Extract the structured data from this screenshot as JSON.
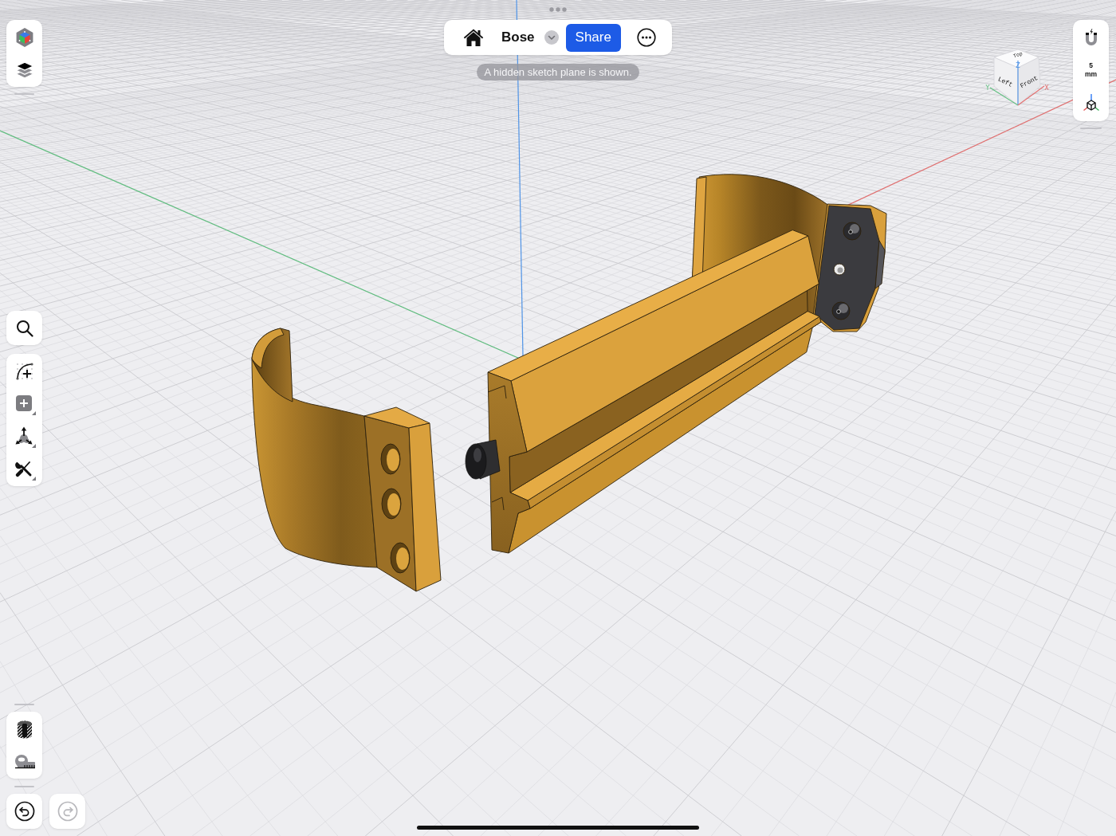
{
  "top_bar": {
    "document_name": "Bose",
    "share_label": "Share"
  },
  "notice": "A hidden sketch plane is shown.",
  "snap": {
    "value": "5",
    "unit": "mm"
  },
  "view_cube": {
    "faces": [
      {
        "kind": "top",
        "label": "Top"
      },
      {
        "kind": "left",
        "label": "Left"
      },
      {
        "kind": "front",
        "label": "Front"
      }
    ],
    "axes": [
      {
        "kind": "z",
        "label": "Z",
        "color": "#4f93e6"
      },
      {
        "kind": "y",
        "label": "Y",
        "color": "#5fbf7f"
      },
      {
        "kind": "x",
        "label": "X",
        "color": "#e46f6f"
      }
    ]
  },
  "history": {
    "undo_disabled": false,
    "redo_disabled": true
  }
}
